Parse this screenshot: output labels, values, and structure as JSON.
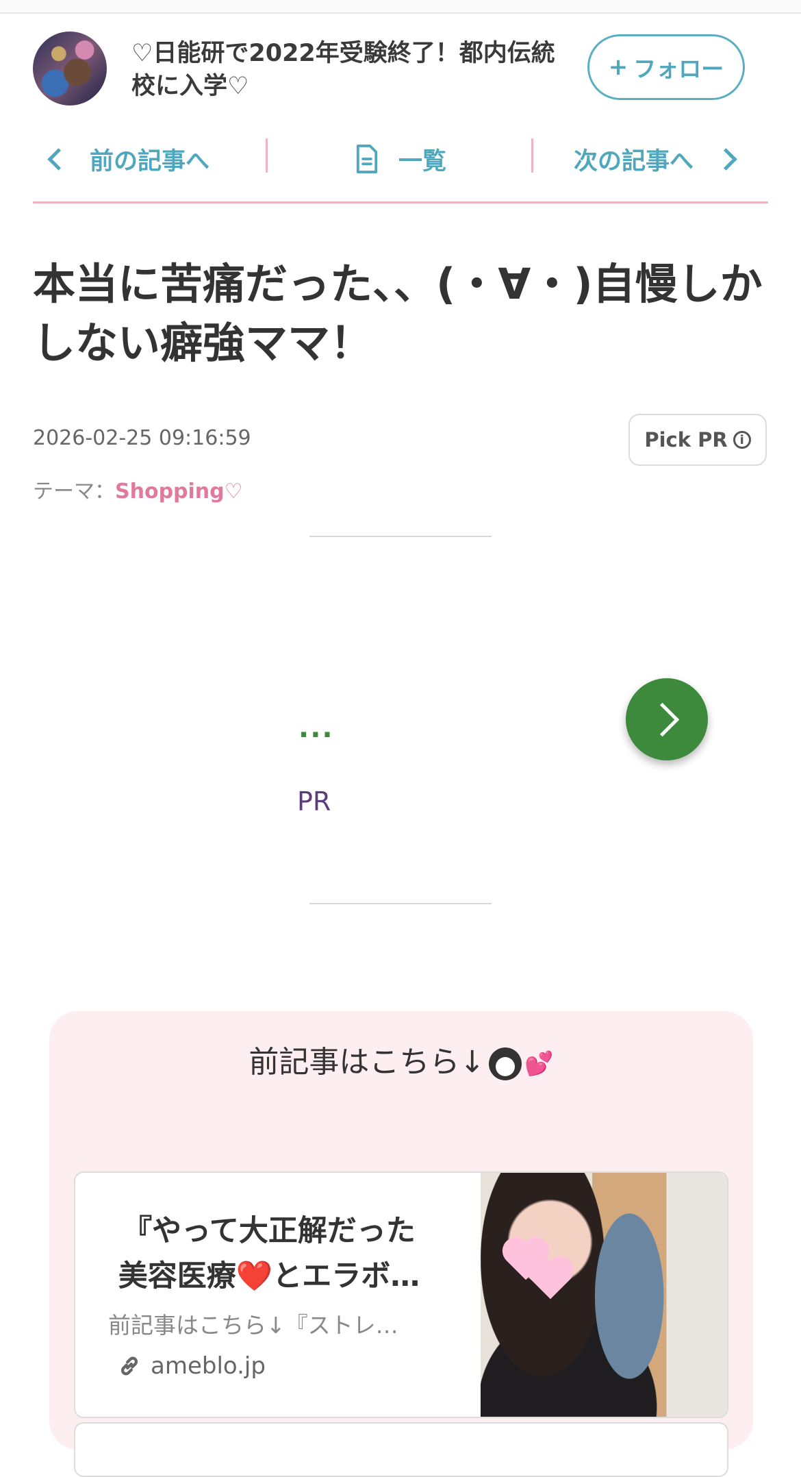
{
  "header": {
    "blog_title": "♡日能研で2022年受験終了！都内伝統校に入学♡",
    "follow_label": "フォロー",
    "follow_plus": "+"
  },
  "nav": {
    "prev_label": "前の記事へ",
    "list_label": "一覧",
    "next_label": "次の記事へ"
  },
  "article": {
    "title": "本当に苦痛だった、、(・∀・)自慢しかしない癖強ママ！",
    "date": "2026-02-25 09:16:59",
    "pick_pr_label": "Pick PR",
    "theme_prefix": "テーマ：",
    "theme_name": "Shopping♡"
  },
  "ad": {
    "dots": "...",
    "pr_label": "PR"
  },
  "related": {
    "heading": "前記事はこちら↓",
    "card": {
      "title": "『やって大正解だった美容医療❤️とエラボ…",
      "description": "前記事はこちら↓『ストレ…",
      "domain": "ameblo.jp"
    }
  },
  "colors": {
    "accent_blue": "#4ea7bd",
    "accent_pink": "#efb3c1",
    "theme_pink": "#e07a9a",
    "ad_green": "#3d8a3d",
    "box_pink": "#fdeef2"
  }
}
